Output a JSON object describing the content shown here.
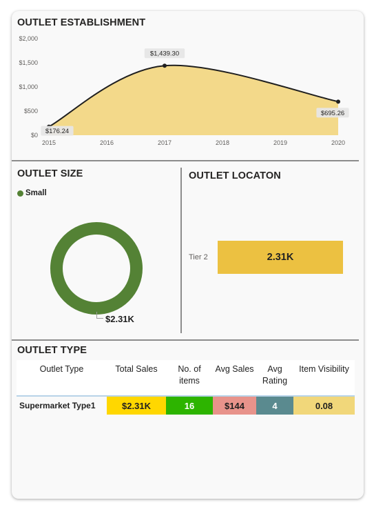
{
  "colors": {
    "area_fill": "#f3d98a",
    "line": "#1f1f1f",
    "donut": "#548235",
    "tier_bar": "#ecc141",
    "total_sales_cell": "#ffd700",
    "items_cell": "#2db400",
    "avg_sales_cell": "#e8938b",
    "avg_rating_cell": "#5a8a8f",
    "visibility_cell": "#f1d77a"
  },
  "establishment": {
    "title": "OUTLET ESTABLISHMENT"
  },
  "size": {
    "title": "OUTLET SIZE",
    "legend_label": "Small",
    "donut_value": "$2.31K"
  },
  "location": {
    "title": "OUTLET LOCATON",
    "category": "Tier 2",
    "value_label": "2.31K"
  },
  "type_table": {
    "title": "OUTLET TYPE",
    "headers": [
      "Outlet Type",
      "Total Sales",
      "No. of items",
      "Avg Sales",
      "Avg Rating",
      "Item Visibility"
    ],
    "rows": [
      [
        "Supermarket Type1",
        "$2.31K",
        "16",
        "$144",
        "4",
        "0.08"
      ]
    ]
  },
  "chart_data": [
    {
      "type": "area",
      "x": [
        2015,
        2017,
        2020
      ],
      "y": [
        176.24,
        1439.3,
        695.26
      ],
      "data_labels": [
        "$176.24",
        "$1,439.30",
        "$695.26"
      ],
      "xticks": [
        "2015",
        "2016",
        "2017",
        "2018",
        "2019",
        "2020"
      ],
      "yticks": [
        "$0",
        "$500",
        "$1,000",
        "$1,500",
        "$2,000"
      ],
      "ylim": [
        0,
        2000
      ],
      "xlim": [
        2015,
        2020
      ],
      "grid": false,
      "title": "OUTLET ESTABLISHMENT"
    },
    {
      "type": "pie",
      "style": "donut",
      "categories": [
        "Small"
      ],
      "values": [
        2310
      ],
      "data_labels": [
        "$2.31K"
      ],
      "legend": "top-left"
    },
    {
      "type": "bar",
      "orientation": "horizontal",
      "categories": [
        "Tier 2"
      ],
      "values": [
        2310
      ],
      "data_labels": [
        "2.31K"
      ]
    }
  ]
}
